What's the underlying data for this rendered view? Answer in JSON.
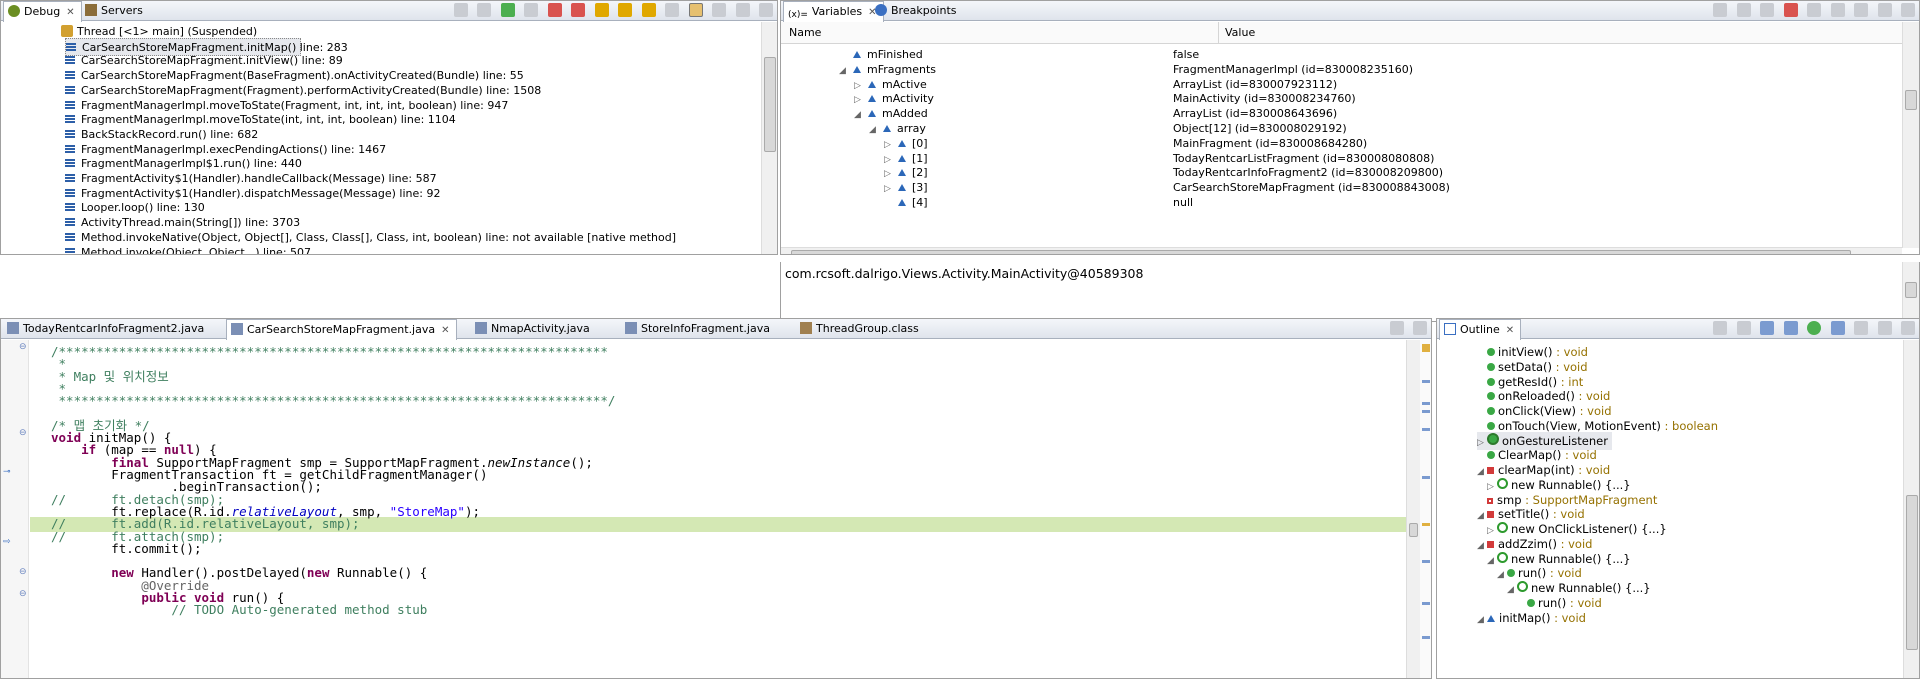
{
  "debug": {
    "tabs": [
      {
        "label": "Debug",
        "icon": "debug-icon",
        "active": true
      },
      {
        "label": "Servers",
        "icon": "servers-icon",
        "active": false
      }
    ],
    "thread_label": "Thread [<1> main] (Suspended)",
    "frames": [
      "CarSearchStoreMapFragment.initMap() line: 283",
      "CarSearchStoreMapFragment.initView() line: 89",
      "CarSearchStoreMapFragment(BaseFragment).onActivityCreated(Bundle) line: 55",
      "CarSearchStoreMapFragment(Fragment).performActivityCreated(Bundle) line: 1508",
      "FragmentManagerImpl.moveToState(Fragment, int, int, int, boolean) line: 947",
      "FragmentManagerImpl.moveToState(int, int, int, boolean) line: 1104",
      "BackStackRecord.run() line: 682",
      "FragmentManagerImpl.execPendingActions() line: 1467",
      "FragmentManagerImpl$1.run() line: 440",
      "FragmentActivity$1(Handler).handleCallback(Message) line: 587",
      "FragmentActivity$1(Handler).dispatchMessage(Message) line: 92",
      "Looper.loop() line: 130",
      "ActivityThread.main(String[]) line: 3703",
      "Method.invokeNative(Object, Object[], Class, Class[], Class, int, boolean) line: not available [native method]",
      "Method.invoke(Object, Object...) line: 507"
    ]
  },
  "variables": {
    "tabs": [
      {
        "label": "Variables",
        "icon": "variables-icon",
        "active": true
      },
      {
        "label": "Breakpoints",
        "icon": "breakpoints-icon",
        "active": false
      }
    ],
    "col_name": "Name",
    "col_value": "Value",
    "rows": [
      {
        "name": "mFinished",
        "value": "false",
        "indent": 0,
        "expander": ""
      },
      {
        "name": "mFragments",
        "value": "FragmentManagerImpl  (id=830008235160)",
        "indent": 0,
        "expander": "▲"
      },
      {
        "name": "mActive",
        "value": "ArrayList  (id=830007923112)",
        "indent": 1,
        "expander": "▷"
      },
      {
        "name": "mActivity",
        "value": "MainActivity  (id=830008234760)",
        "indent": 1,
        "expander": "▷"
      },
      {
        "name": "mAdded",
        "value": "ArrayList  (id=830008643696)",
        "indent": 1,
        "expander": "▲"
      },
      {
        "name": "array",
        "value": "Object[12]  (id=830008029192)",
        "indent": 2,
        "expander": "▲"
      },
      {
        "name": "[0]",
        "value": "MainFragment  (id=830008684280)",
        "indent": 3,
        "expander": "▷"
      },
      {
        "name": "[1]",
        "value": "TodayRentcarListFragment  (id=830008080808)",
        "indent": 3,
        "expander": "▷"
      },
      {
        "name": "[2]",
        "value": "TodayRentcarInfoFragment2  (id=830008209800)",
        "indent": 3,
        "expander": "▷"
      },
      {
        "name": "[3]",
        "value": "CarSearchStoreMapFragment  (id=830008843008)",
        "indent": 3,
        "expander": "▷"
      },
      {
        "name": "[4]",
        "value": "null",
        "indent": 3,
        "expander": ""
      }
    ],
    "detail_text": "com.rcsoft.dalrigo.Views.Activity.MainActivity@40589308"
  },
  "editor": {
    "tabs": [
      {
        "label": "TodayRentcarInfoFragment2.java",
        "active": false
      },
      {
        "label": "CarSearchStoreMapFragment.java",
        "active": true
      },
      {
        "label": "NmapActivity.java",
        "active": false
      },
      {
        "label": "StoreInfoFragment.java",
        "active": false
      },
      {
        "label": "ThreadGroup.class",
        "active": false
      }
    ],
    "lines": [
      "/*************************************************************************",
      " *",
      " * Map 및 위치정보",
      " *",
      " *************************************************************************/",
      "",
      "/* 맵 초기화 */",
      "void initMap() {",
      "    if (map == null) {",
      "        final SupportMapFragment smp = SupportMapFragment.newInstance();",
      "        FragmentTransaction ft = getChildFragmentManager()",
      "                .beginTransaction();",
      "//      ft.detach(smp);",
      "        ft.replace(R.id.relativeLayout, smp, \"StoreMap\");",
      "//      ft.add(R.id.relativeLayout, smp);",
      "//      ft.attach(smp);",
      "        ft.commit();",
      "",
      "        new Handler().postDelayed(new Runnable() {",
      "            @Override",
      "            public void run() {",
      "                // TODO Auto-generated method stub"
    ]
  },
  "outline": {
    "tab_label": "Outline",
    "items": [
      {
        "name": "initView()",
        "type": " : void",
        "indent": 1,
        "kind": "method-public",
        "expander": ""
      },
      {
        "name": "setData()",
        "type": " : void",
        "indent": 1,
        "kind": "method-public",
        "expander": ""
      },
      {
        "name": "getResId()",
        "type": " : int",
        "indent": 1,
        "kind": "method-public",
        "expander": ""
      },
      {
        "name": "onReloaded()",
        "type": " : void",
        "indent": 1,
        "kind": "method-public",
        "expander": ""
      },
      {
        "name": "onClick(View)",
        "type": " : void",
        "indent": 1,
        "kind": "method-public",
        "expander": ""
      },
      {
        "name": "onTouch(View, MotionEvent)",
        "type": " : boolean",
        "indent": 1,
        "kind": "method-public",
        "expander": ""
      },
      {
        "name": "onGestureListener",
        "type": "",
        "indent": 1,
        "kind": "field-class",
        "expander": "▷"
      },
      {
        "name": "ClearMap()",
        "type": " : void",
        "indent": 1,
        "kind": "method-public",
        "expander": ""
      },
      {
        "name": "clearMap(int)",
        "type": " : void",
        "indent": 1,
        "kind": "method-private",
        "expander": "▲"
      },
      {
        "name": "new Runnable() {...}",
        "type": "",
        "indent": 2,
        "kind": "anon",
        "expander": "▷"
      },
      {
        "name": "smp",
        "type": " : SupportMapFragment",
        "indent": 1,
        "kind": "field-private",
        "expander": ""
      },
      {
        "name": "setTitle()",
        "type": " : void",
        "indent": 1,
        "kind": "method-private",
        "expander": "▲"
      },
      {
        "name": "new OnClickListener() {...}",
        "type": "",
        "indent": 2,
        "kind": "anon",
        "expander": "▷"
      },
      {
        "name": "addZzim()",
        "type": " : void",
        "indent": 1,
        "kind": "method-private",
        "expander": "▲"
      },
      {
        "name": "new Runnable() {...}",
        "type": "",
        "indent": 2,
        "kind": "anon",
        "expander": "▲"
      },
      {
        "name": "run()",
        "type": " : void",
        "indent": 3,
        "kind": "method-public",
        "expander": "▲"
      },
      {
        "name": "new Runnable() {...}",
        "type": "",
        "indent": 4,
        "kind": "anon",
        "expander": "▲"
      },
      {
        "name": "run()",
        "type": " : void",
        "indent": 5,
        "kind": "method-public",
        "expander": ""
      },
      {
        "name": "initMap()",
        "type": " : void",
        "indent": 1,
        "kind": "method-default",
        "expander": "▲"
      }
    ]
  },
  "colors": {
    "selection": "#e6e8ed",
    "highlight_line": "#d4e8b4",
    "keyword": "#7f0055",
    "comment": "#3f7f5f",
    "string": "#2a00ff"
  }
}
